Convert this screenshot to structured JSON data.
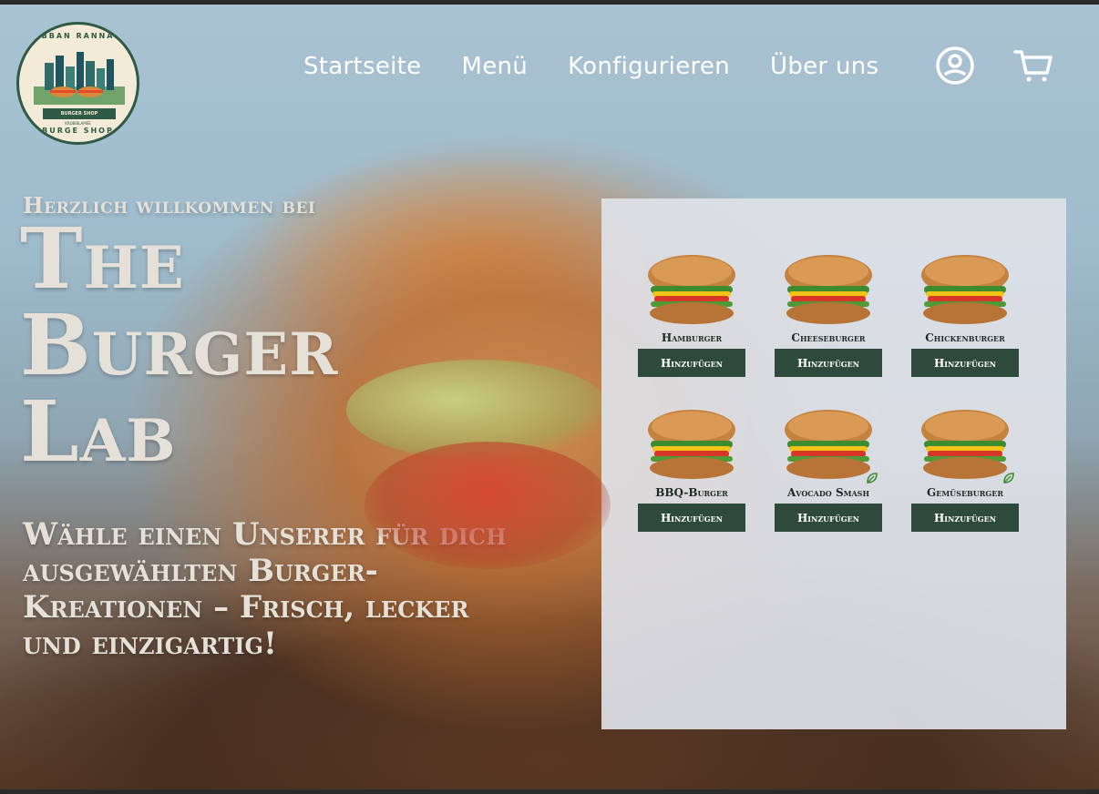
{
  "logo": {
    "ring_top": "URBBAN RANNACH",
    "ring_bottom": "BURGE SHOP",
    "banner": "BURGER SHOP",
    "tagline": "KRUBIBLAMEE"
  },
  "nav": {
    "items": [
      {
        "label": "Startseite"
      },
      {
        "label": "Menü"
      },
      {
        "label": "Konfigurieren"
      },
      {
        "label": "Über uns"
      }
    ],
    "user_icon": "user-circle-icon",
    "cart_icon": "cart-icon"
  },
  "hero": {
    "kicker": "Herzlich willkommen bei",
    "title_line1": "The",
    "title_line2": "Burger",
    "title_line3": "Lab",
    "subtitle": "Wähle einen Unserer für dich ausgewählten Burger-Kreationen – Frisch, lecker und einzigartig!"
  },
  "menu": {
    "items": [
      {
        "name": "Hamburger",
        "button": "Hinzufügen",
        "vegetarian": false
      },
      {
        "name": "Cheeseburger",
        "button": "Hinzufügen",
        "vegetarian": false
      },
      {
        "name": "Chickenburger",
        "button": "Hinzufügen",
        "vegetarian": false
      },
      {
        "name": "BBQ-Burger",
        "button": "Hinzufügen",
        "vegetarian": false
      },
      {
        "name": "Avocado Smash",
        "button": "Hinzufügen",
        "vegetarian": true
      },
      {
        "name": "Gemüseburger",
        "button": "Hinzufügen",
        "vegetarian": true
      }
    ]
  },
  "colors": {
    "accent_green": "#2e4a3c",
    "hero_text": "#e6e1d8",
    "panel_bg": "#dee2e8"
  }
}
